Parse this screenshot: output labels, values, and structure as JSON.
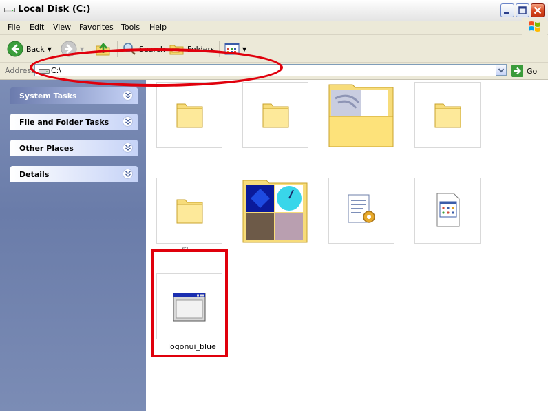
{
  "window": {
    "title": "Local Disk (C:)"
  },
  "menu": {
    "items": [
      "File",
      "Edit",
      "View",
      "Favorites",
      "Tools",
      "Help"
    ]
  },
  "toolbar": {
    "back_label": "Back",
    "search_label": "Search",
    "folders_label": "Folders"
  },
  "address": {
    "label": "Address",
    "value": "C:\\",
    "go_label": "Go"
  },
  "taskpane": {
    "panels": [
      {
        "title": "System Tasks",
        "expanded": false,
        "active": true
      },
      {
        "title": "File and Folder Tasks",
        "expanded": false,
        "active": false
      },
      {
        "title": "Other Places",
        "expanded": false,
        "active": false
      },
      {
        "title": "Details",
        "expanded": false,
        "active": false
      }
    ]
  },
  "files": [
    {
      "kind": "folder",
      "label": ""
    },
    {
      "kind": "folder",
      "label": ""
    },
    {
      "kind": "folder-preview-single",
      "label": ""
    },
    {
      "kind": "folder",
      "label": ""
    },
    {
      "kind": "folder",
      "label": ""
    },
    {
      "kind": "folder-preview-grid",
      "label": ""
    },
    {
      "kind": "config-file",
      "label": ""
    },
    {
      "kind": "executable",
      "label": ""
    },
    {
      "kind": "window-app",
      "label": "logonui_blue"
    }
  ],
  "partial_label": "File",
  "colors": {
    "annotation": "#e0000c",
    "taskpane_bg": "#7b8cb5",
    "task_title": "#215dc6"
  }
}
